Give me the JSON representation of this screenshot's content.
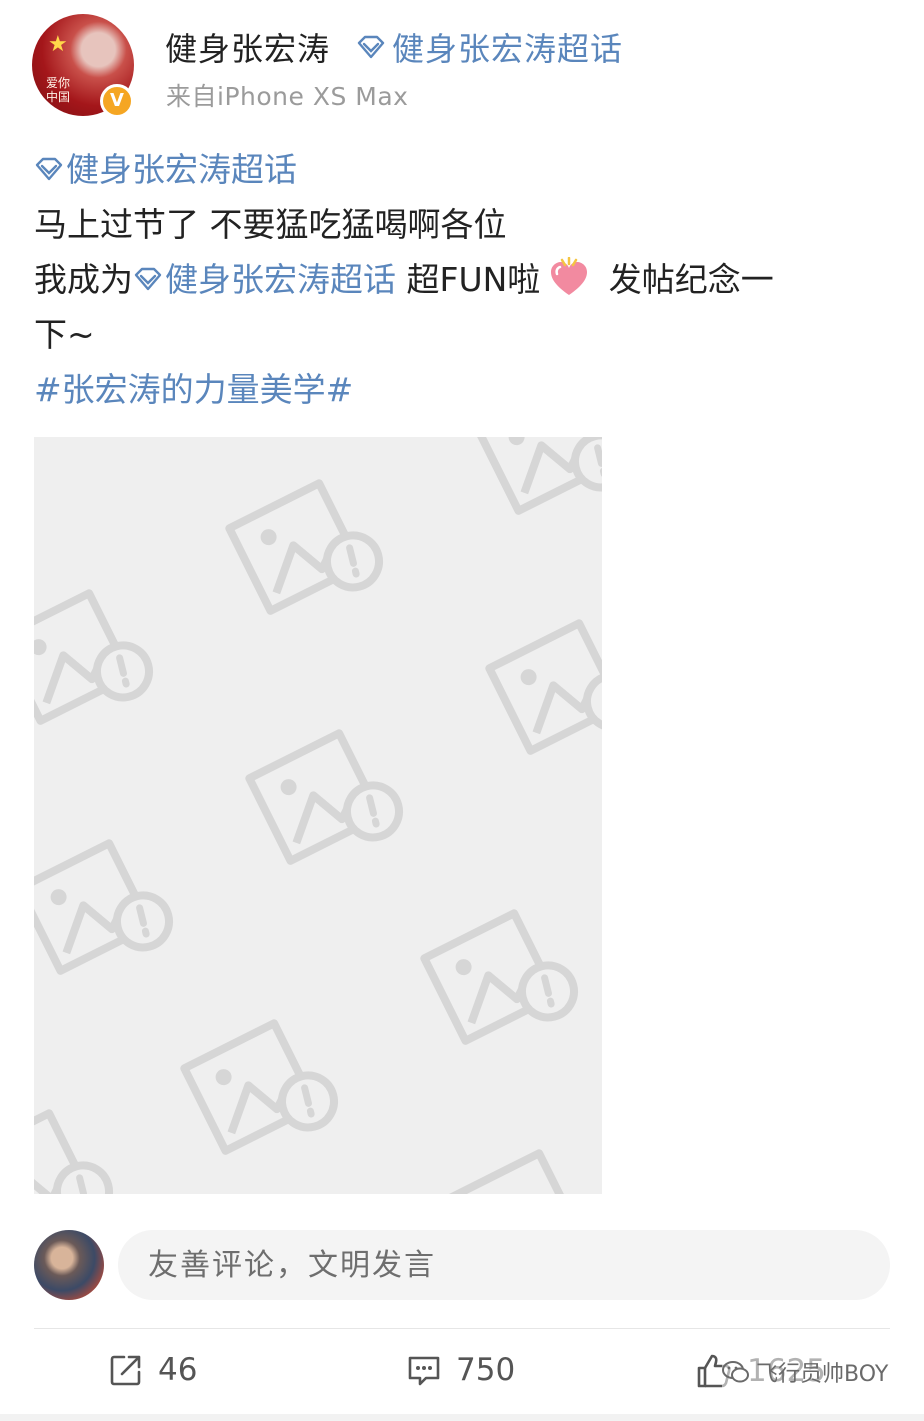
{
  "header": {
    "username": "健身张宏涛",
    "topic": "健身张宏涛超话",
    "source": "来自iPhone XS Max",
    "avatar_text": "爱你中国",
    "verified_badge": "V"
  },
  "post": {
    "line1_topic": "健身张宏涛超话",
    "line2": "马上过节了 不要猛吃猛喝啊各位",
    "line3_pre": "我成为",
    "line3_topic": "健身张宏涛超话",
    "line3_mid": " 超FUN啦",
    "line3_post": " 发帖纪念一",
    "line4": "下~",
    "hashtag": "#张宏涛的力量美学#"
  },
  "comment": {
    "placeholder": "友善评论，文明发言"
  },
  "actions": {
    "reposts": "46",
    "comments": "750",
    "likes": "1625"
  },
  "watermark": {
    "text": "飞行员帅BOY"
  },
  "colors": {
    "link": "#5a86bc",
    "placeholder_bg": "#efefef",
    "badge": "#f5a623"
  }
}
